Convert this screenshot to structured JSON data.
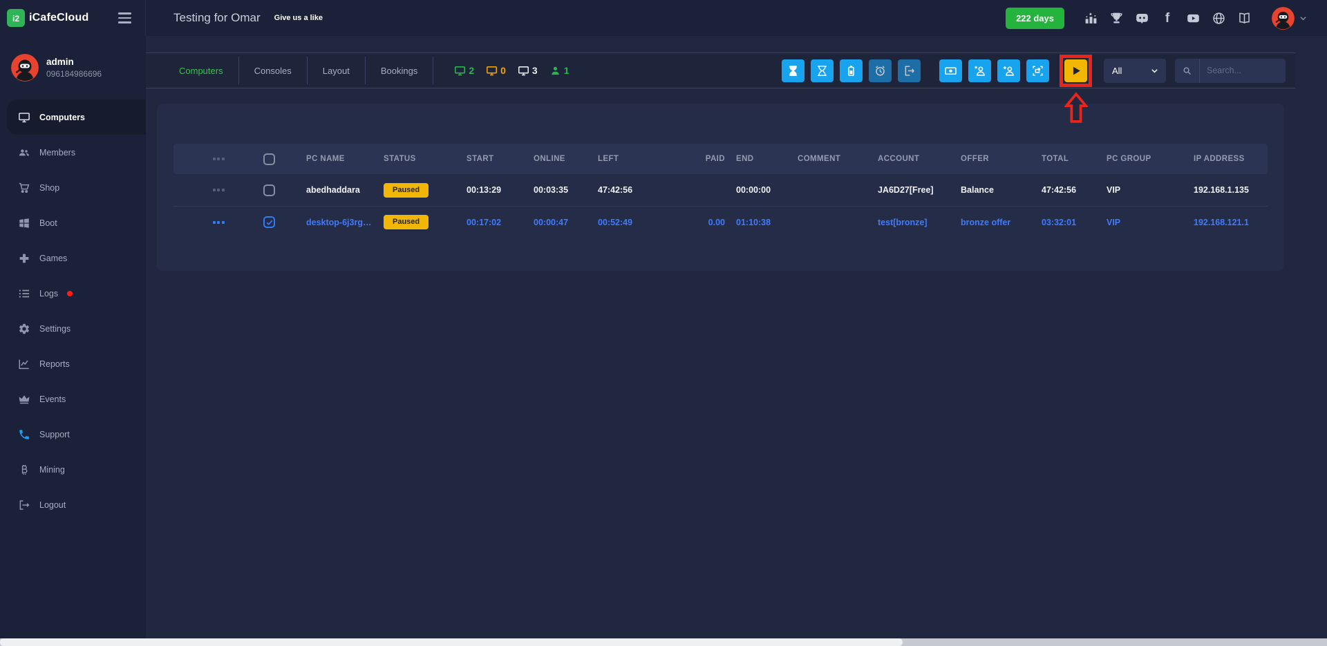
{
  "theme": {
    "accent_green": "#2eb44e",
    "accent_blue": "#18a3ef",
    "muted_blue": "#1d6ea6",
    "accent_yellow": "#f2b705",
    "link_blue": "#3e7bff",
    "annotation_red": "#e8251d",
    "avatar_red": "#e8432e"
  },
  "topbar": {
    "logo_mark": "i2",
    "logo_text": "iCafeCloud",
    "title": "Testing for Omar",
    "like_label": "Give us a like",
    "days_badge": "222 days",
    "icons": [
      "leaderboard-icon",
      "trophy-icon",
      "discord-icon",
      "facebook-icon",
      "youtube-icon",
      "globe-icon",
      "manual-icon"
    ]
  },
  "sidebar": {
    "user": {
      "name": "admin",
      "phone": "096184986696"
    },
    "items": [
      {
        "label": "Computers",
        "icon": "monitor",
        "active": true
      },
      {
        "label": "Members",
        "icon": "users"
      },
      {
        "label": "Shop",
        "icon": "cart"
      },
      {
        "label": "Boot",
        "icon": "windows"
      },
      {
        "label": "Games",
        "icon": "gamepad"
      },
      {
        "label": "Logs",
        "icon": "list",
        "has_alert": true
      },
      {
        "label": "Settings",
        "icon": "gear"
      },
      {
        "label": "Reports",
        "icon": "chart"
      },
      {
        "label": "Events",
        "icon": "crown"
      },
      {
        "label": "Support",
        "icon": "phone"
      },
      {
        "label": "Mining",
        "icon": "bitcoin"
      },
      {
        "label": "Logout",
        "icon": "logout"
      }
    ]
  },
  "content": {
    "tabs": [
      {
        "label": "Computers",
        "active": true
      },
      {
        "label": "Consoles"
      },
      {
        "label": "Layout"
      },
      {
        "label": "Bookings"
      }
    ],
    "counters": [
      {
        "icon": "monitor",
        "value": "2",
        "color": "green"
      },
      {
        "icon": "monitor",
        "value": "0",
        "color": "orange"
      },
      {
        "icon": "monitor",
        "value": "3",
        "color": "white"
      },
      {
        "icon": "member",
        "value": "1",
        "color": "green"
      }
    ],
    "toolbar_buttons": [
      "hourglass-filled",
      "hourglass-outline",
      "battery",
      "alarm",
      "sign-out",
      "cash",
      "member-star",
      "member-add",
      "screenshot",
      "resume-play"
    ],
    "filter_value": "All",
    "search_placeholder": "Search..."
  },
  "annotation": {
    "target": "resume-play-button",
    "shape": "red highlight box with upward red arrow"
  },
  "table": {
    "headers": {
      "pc_name": "PC NAME",
      "status": "STATUS",
      "start": "START",
      "online": "ONLINE",
      "left": "LEFT",
      "paid": "PAID",
      "end": "END",
      "comment": "COMMENT",
      "account": "ACCOUNT",
      "offer": "OFFER",
      "total": "TOTAL",
      "pc_group": "PC GROUP",
      "ip": "IP ADDRESS"
    },
    "rows": [
      {
        "pc_name": "abedhaddara",
        "status": "Paused",
        "start": "00:13:29",
        "online": "00:03:35",
        "left": "47:42:56",
        "paid": "",
        "end": "00:00:00",
        "comment": "",
        "account": "JA6D27[Free]",
        "offer": "Balance",
        "total": "47:42:56",
        "pc_group": "VIP",
        "ip": "192.168.1.135",
        "checked": false
      },
      {
        "pc_name": "desktop-6j3rg…",
        "status": "Paused",
        "start": "00:17:02",
        "online": "00:00:47",
        "left": "00:52:49",
        "paid": "0.00",
        "end": "01:10:38",
        "comment": "",
        "account": "test[bronze]",
        "offer": "bronze offer",
        "total": "03:32:01",
        "pc_group": "VIP",
        "ip": "192.168.121.1",
        "checked": true
      }
    ]
  }
}
